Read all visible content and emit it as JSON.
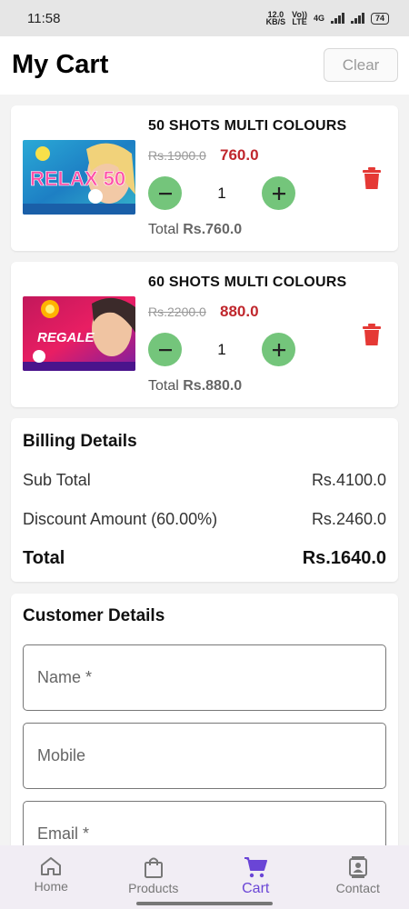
{
  "status_bar": {
    "time": "11:58",
    "net_speed_value": "12.0",
    "net_speed_unit": "KB/S",
    "volte_top": "Vo))",
    "volte_bottom": "LTE",
    "network": "4G",
    "battery": "74"
  },
  "header": {
    "title": "My Cart",
    "clear_label": "Clear"
  },
  "cart_items": [
    {
      "name": "50 SHOTS MULTI COLOURS",
      "original_price": "Rs.1900.0",
      "price": "760.0",
      "quantity": "1",
      "total_label": "Total",
      "total_value": "Rs.760.0",
      "image_text": "RELAX 50"
    },
    {
      "name": "60 SHOTS MULTI COLOURS",
      "original_price": "Rs.2200.0",
      "price": "880.0",
      "quantity": "1",
      "total_label": "Total",
      "total_value": "Rs.880.0",
      "image_text": "REGALE"
    }
  ],
  "billing": {
    "title": "Billing Details",
    "subtotal_label": "Sub Total",
    "subtotal_value": "Rs.4100.0",
    "discount_label": "Discount Amount (60.00%)",
    "discount_value": "Rs.2460.0",
    "total_label": "Total",
    "total_value": "Rs.1640.0"
  },
  "customer": {
    "title": "Customer Details",
    "name_placeholder": "Name *",
    "mobile_placeholder": "Mobile",
    "email_placeholder": "Email *"
  },
  "nav": {
    "home": "Home",
    "products": "Products",
    "cart": "Cart",
    "contact": "Contact"
  },
  "colors": {
    "accent": "#6a45d6",
    "price_red": "#c0272d",
    "qty_green": "#74c57b",
    "delete_red": "#e53935"
  }
}
